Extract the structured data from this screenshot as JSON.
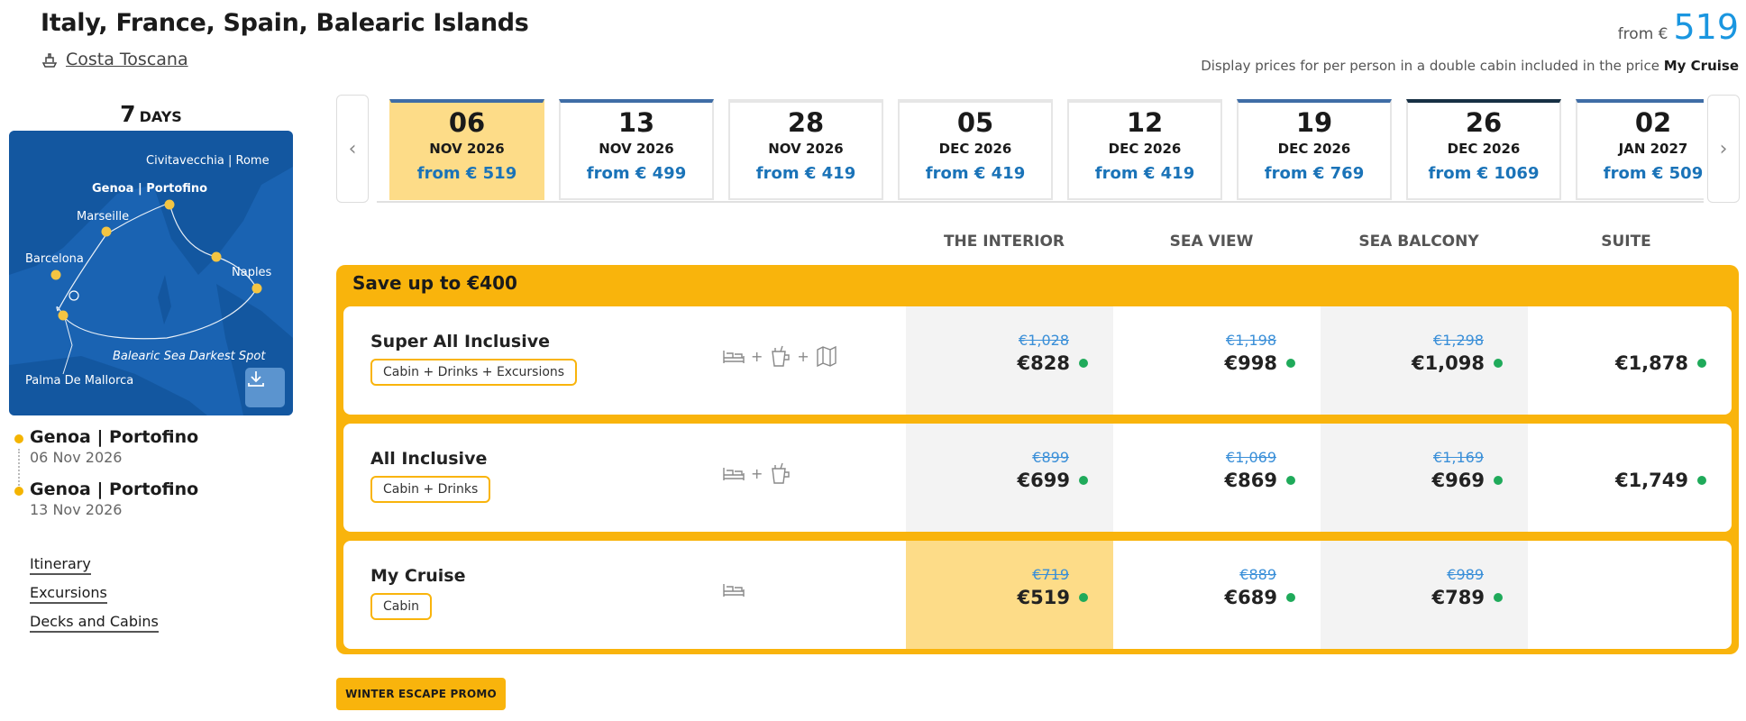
{
  "header": {
    "title": "Italy, France, Spain, Balearic Islands",
    "ship": "Costa Toscana",
    "price_from_label": "from €",
    "price_from_value": "519",
    "price_note_prefix": "Display prices for per person in a double cabin included in the price",
    "price_note_bold": "My Cruise"
  },
  "itinerary": {
    "days_number": "7",
    "days_label": "DAYS",
    "map_labels": {
      "civitavecchia": "Civitavecchia | Rome",
      "genoa": "Genoa | Portofino",
      "marseille": "Marseille",
      "barcelona": "Barcelona",
      "naples": "Naples",
      "balearic": "Balearic Sea Darkest Spot",
      "palma": "Palma De Mallorca"
    },
    "ports": [
      {
        "name": "Genoa | Portofino",
        "date": "06 Nov 2026"
      },
      {
        "name": "Genoa | Portofino",
        "date": "13 Nov 2026"
      }
    ],
    "links": [
      "Itinerary",
      "Excursions",
      "Decks and Cabins"
    ]
  },
  "dates": [
    {
      "day": "06",
      "month": "NOV 2026",
      "price": "from € 519"
    },
    {
      "day": "13",
      "month": "NOV 2026",
      "price": "from € 499"
    },
    {
      "day": "28",
      "month": "NOV 2026",
      "price": "from € 419"
    },
    {
      "day": "05",
      "month": "DEC 2026",
      "price": "from € 419"
    },
    {
      "day": "12",
      "month": "DEC 2026",
      "price": "from € 419"
    },
    {
      "day": "19",
      "month": "DEC 2026",
      "price": "from € 769"
    },
    {
      "day": "26",
      "month": "DEC 2026",
      "price": "from € 1069"
    },
    {
      "day": "02",
      "month": "JAN 2027",
      "price": "from € 509"
    }
  ],
  "columns": [
    "THE INTERIOR",
    "SEA VIEW",
    "SEA BALCONY",
    "SUITE"
  ],
  "offer": {
    "headline": "Save up to €400",
    "packages": [
      {
        "name": "Super All Inclusive",
        "tag": "Cabin + Drinks + Excursions",
        "prices": [
          {
            "old": "€1,028",
            "new": "€828"
          },
          {
            "old": "€1,198",
            "new": "€998"
          },
          {
            "old": "€1,298",
            "new": "€1,098"
          },
          {
            "old": "",
            "new": "€1,878"
          }
        ]
      },
      {
        "name": "All Inclusive",
        "tag": "Cabin + Drinks",
        "prices": [
          {
            "old": "€899",
            "new": "€699"
          },
          {
            "old": "€1,069",
            "new": "€869"
          },
          {
            "old": "€1,169",
            "new": "€969"
          },
          {
            "old": "",
            "new": "€1,749"
          }
        ]
      },
      {
        "name": "My Cruise",
        "tag": "Cabin",
        "prices": [
          {
            "old": "€719",
            "new": "€519"
          },
          {
            "old": "€889",
            "new": "€689"
          },
          {
            "old": "€989",
            "new": "€789"
          }
        ]
      }
    ]
  },
  "promo_label": "WINTER ESCAPE PROMO",
  "colors": {
    "accent_yellow": "#f9b40c",
    "selected_cell": "#fddc88",
    "price_blue": "#1a96e0",
    "availability_green": "#1faa5a"
  }
}
